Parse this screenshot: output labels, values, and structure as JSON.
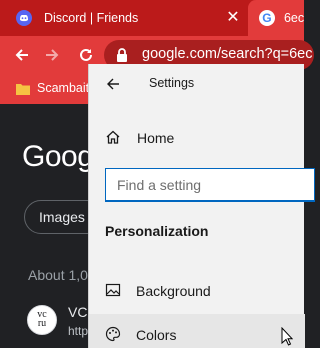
{
  "browser": {
    "tabs": [
      {
        "title": "Discord | Friends",
        "favicon": "discord-icon"
      },
      {
        "title": "6ec",
        "favicon": "google-icon"
      }
    ],
    "close_glyph": "✕",
    "google_favicon_letter": "G",
    "url": "google.com/search?q=6ec",
    "bookmark": {
      "label": "Scambait",
      "icon": "folder-icon"
    }
  },
  "google": {
    "logo": "Goog",
    "chips": [
      "Images"
    ],
    "results_stats": "About 1,0",
    "result": {
      "avatar_line1": "vc",
      "avatar_line2": "ru",
      "title": "VC",
      "url": "http"
    }
  },
  "settings": {
    "title": "Settings",
    "home_label": "Home",
    "search_placeholder": "Find a setting",
    "section": "Personalization",
    "items": [
      {
        "label": "Background",
        "icon": "picture-icon"
      },
      {
        "label": "Colors",
        "icon": "palette-icon",
        "selected": true
      }
    ]
  },
  "colors": {
    "tab_strip": "#bb1a1a",
    "toolbar": "#e23b3b",
    "settings_bg": "#f2f2f2",
    "accent": "#0067c0"
  }
}
